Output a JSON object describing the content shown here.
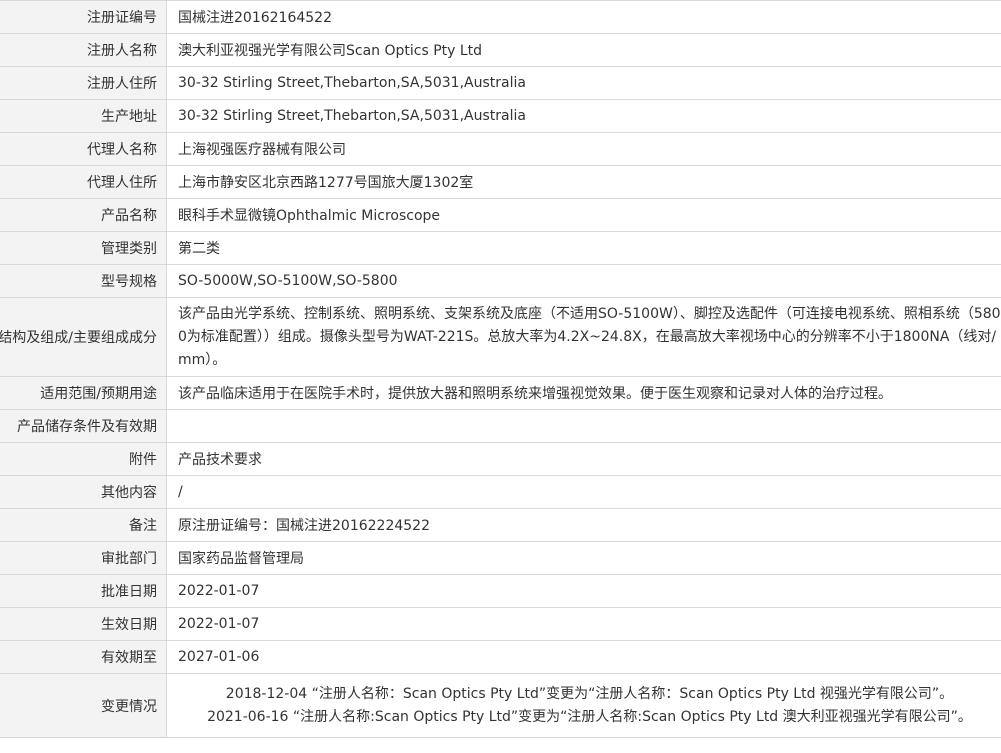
{
  "rows": [
    {
      "label": "注册证编号",
      "value": "国械注进20162164522"
    },
    {
      "label": "注册人名称",
      "value": "澳大利亚视强光学有限公司Scan Optics Pty Ltd"
    },
    {
      "label": "注册人住所",
      "value": "30-32 Stirling Street,Thebarton,SA,5031,Australia"
    },
    {
      "label": "生产地址",
      "value": "30-32 Stirling Street,Thebarton,SA,5031,Australia"
    },
    {
      "label": "代理人名称",
      "value": "上海视强医疗器械有限公司"
    },
    {
      "label": "代理人住所",
      "value": "上海市静安区北京西路1277号国旅大厦1302室"
    },
    {
      "label": "产品名称",
      "value": "眼科手术显微镜Ophthalmic Microscope"
    },
    {
      "label": "管理类别",
      "value": "第二类"
    },
    {
      "label": "型号规格",
      "value": "SO-5000W,SO-5100W,SO-5800"
    },
    {
      "label": "结构及组成/主要组成成分",
      "value": "该产品由光学系统、控制系统、照明系统、支架系统及底座（不适用SO-5100W）、脚控及选配件（可连接电视系统、照相系统（5800为标准配置））组成。摄像头型号为WAT-221S。总放大率为4.2X~24.8X，在最高放大率视场中心的分辨率不小于1800NA（线对/mm）。"
    },
    {
      "label": "适用范围/预期用途",
      "value": "该产品临床适用于在医院手术时，提供放大器和照明系统来增强视觉效果。便于医生观察和记录对人体的治疗过程。"
    },
    {
      "label": "产品储存条件及有效期",
      "value": ""
    },
    {
      "label": "附件",
      "value": "产品技术要求"
    },
    {
      "label": "其他内容",
      "value": "/"
    },
    {
      "label": "备注",
      "value": "原注册证编号：国械注进20162224522"
    },
    {
      "label": "审批部门",
      "value": "国家药品监督管理局"
    },
    {
      "label": "批准日期",
      "value": "2022-01-07"
    },
    {
      "label": "生效日期",
      "value": "2022-01-07"
    },
    {
      "label": "有效期至",
      "value": "2027-01-06"
    },
    {
      "label": "变更情况",
      "changes": [
        "2018-12-04 “注册人名称：Scan Optics Pty Ltd”变更为“注册人名称：Scan Optics Pty Ltd 视强光学有限公司”。",
        "2021-06-16 “注册人名称:Scan Optics Pty Ltd”变更为“注册人名称:Scan Optics Pty Ltd 澳大利亚视强光学有限公司”。"
      ]
    }
  ]
}
